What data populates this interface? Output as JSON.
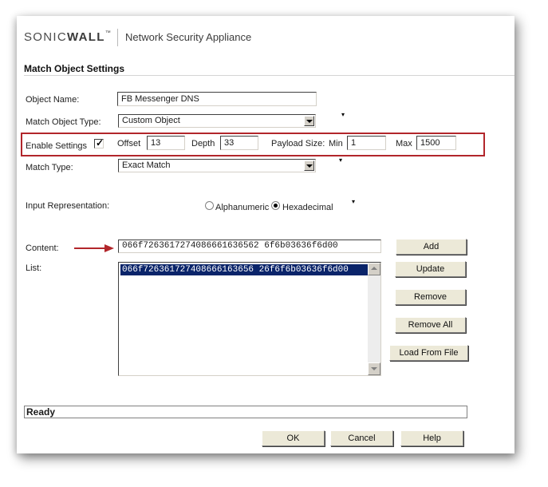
{
  "header": {
    "logo_prefix": "SONIC",
    "logo_suffix": "WALL",
    "logo_tm": "™",
    "product": "Network Security Appliance"
  },
  "section": {
    "title": "Match Object Settings"
  },
  "form": {
    "object_name": {
      "label": "Object Name:",
      "value": "FB Messenger DNS"
    },
    "object_type": {
      "label": "Match Object Type:",
      "value": "Custom Object"
    },
    "enable_settings": {
      "label": "Enable Settings",
      "checked": true,
      "offset_label": "Offset",
      "offset_value": "13",
      "depth_label": "Depth",
      "depth_value": "33",
      "payload_label": "Payload Size:",
      "min_label": "Min",
      "min_value": "1",
      "max_label": "Max",
      "max_value": "1500"
    },
    "match_type": {
      "label": "Match Type:",
      "value": "Exact Match"
    },
    "input_representation": {
      "label": "Input Representation:",
      "options": [
        "Alphanumeric",
        "Hexadecimal"
      ],
      "selected": "Hexadecimal"
    },
    "content": {
      "label": "Content:",
      "value": "066f7263617274086661636562 6f6b03636f6d00"
    },
    "list": {
      "label": "List:",
      "items": [
        "066f726361727408666163656 26f6f6b03636f6d00"
      ]
    }
  },
  "buttons": {
    "add": "Add",
    "update": "Update",
    "remove": "Remove",
    "remove_all": "Remove All",
    "load_from_file": "Load From File",
    "ok": "OK",
    "cancel": "Cancel",
    "help": "Help"
  },
  "status": {
    "text": "Ready"
  },
  "colors": {
    "highlight": "#b2262b",
    "selection": "#0a246a",
    "arrow": "#b2262b"
  }
}
